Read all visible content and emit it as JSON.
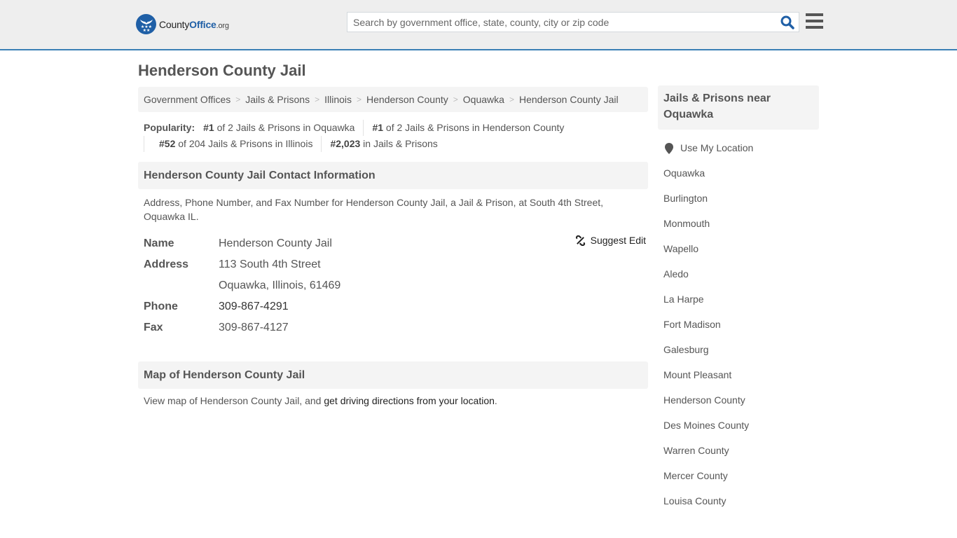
{
  "header": {
    "logo": {
      "county": "County",
      "office": "Office",
      "org": ".org"
    },
    "search_placeholder": "Search by government office, state, county, city or zip code",
    "search_icon": "search-icon",
    "menu_icon": "hamburger-menu-icon",
    "brand_color": "#1f5fa6",
    "accent_line_color": "#3a7fb5"
  },
  "page_title": "Henderson County Jail",
  "breadcrumb": [
    "Government Offices",
    "Jails & Prisons",
    "Illinois",
    "Henderson County",
    "Oquawka",
    "Henderson County Jail"
  ],
  "breadcrumb_separator": ">",
  "popularity": {
    "label": "Popularity:",
    "row1": [
      {
        "rank": "#1",
        "text": " of 2 Jails & Prisons in Oquawka"
      },
      {
        "rank": "#1",
        "text": " of 2 Jails & Prisons in Henderson County"
      }
    ],
    "row2": [
      {
        "rank": "#52",
        "text": " of 204 Jails & Prisons in Illinois"
      },
      {
        "rank": "#2,023",
        "text": " in Jails & Prisons"
      }
    ]
  },
  "contact": {
    "heading": "Henderson County Jail Contact Information",
    "description": "Address, Phone Number, and Fax Number for Henderson County Jail, a Jail & Prison, at South 4th Street, Oquawka IL.",
    "suggest_edit": "Suggest Edit",
    "fields": {
      "name_label": "Name",
      "name_value": "Henderson County Jail",
      "address_label": "Address",
      "address_line1": "113 South 4th Street",
      "address_line2": "Oquawka, Illinois, 61469",
      "phone_label": "Phone",
      "phone_value": "309-867-4291",
      "fax_label": "Fax",
      "fax_value": "309-867-4127"
    }
  },
  "map": {
    "heading": "Map of Henderson County Jail",
    "text_before": "View map of Henderson County Jail, and ",
    "link": "get driving directions from your location",
    "text_after": "."
  },
  "sidebar": {
    "heading": "Jails & Prisons near Oquawka",
    "use_location": "Use My Location",
    "items": [
      "Oquawka",
      "Burlington",
      "Monmouth",
      "Wapello",
      "Aledo",
      "La Harpe",
      "Fort Madison",
      "Galesburg",
      "Mount Pleasant",
      "Henderson County",
      "Des Moines County",
      "Warren County",
      "Mercer County",
      "Louisa County"
    ]
  }
}
